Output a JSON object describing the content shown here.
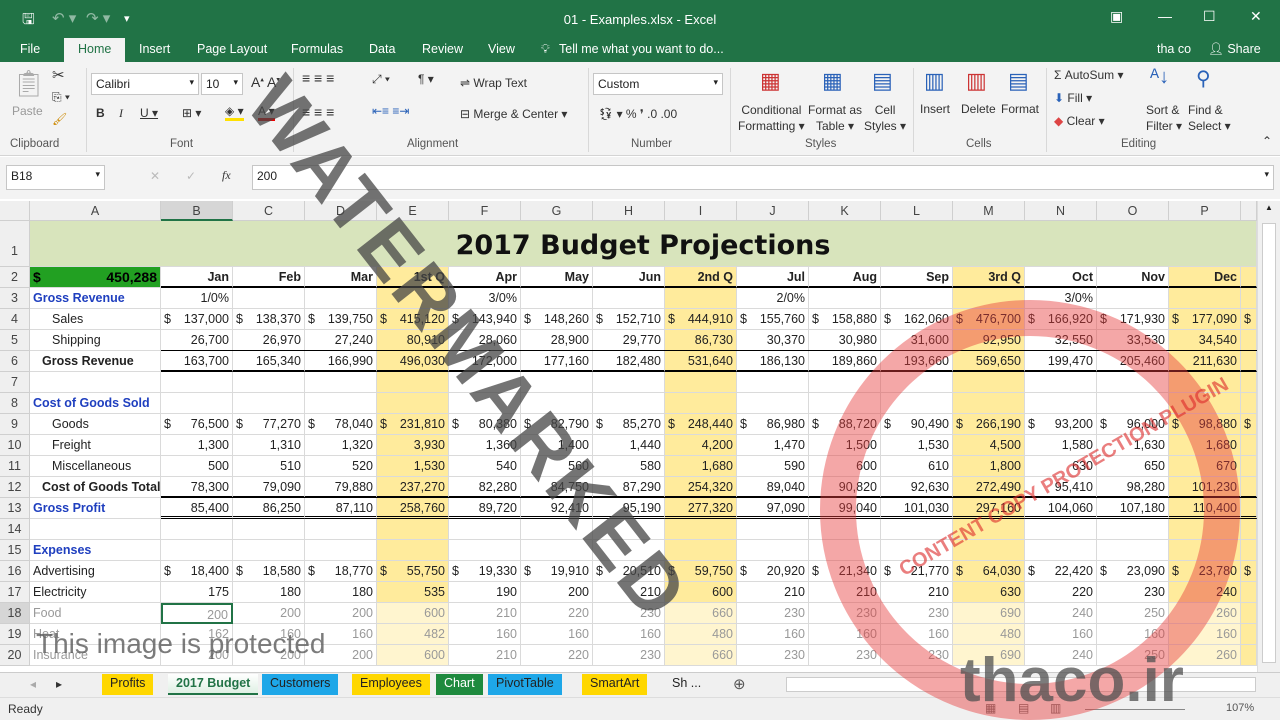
{
  "window": {
    "title": "01 - Examples.xlsx - Excel",
    "user": "tha co",
    "share": "Share"
  },
  "ribbon_tabs": [
    "File",
    "Home",
    "Insert",
    "Page Layout",
    "Formulas",
    "Data",
    "Review",
    "View"
  ],
  "tell_me": "Tell me what you want to do...",
  "ribbon": {
    "paste": "Paste",
    "font_name": "Calibri",
    "font_size": "10",
    "wrap_text": "Wrap Text",
    "merge_center": "Merge & Center",
    "number_format": "Custom",
    "conditional_formatting": [
      "Conditional",
      "Formatting ▾"
    ],
    "format_as_table": [
      "Format as",
      "Table ▾"
    ],
    "cell_styles": [
      "Cell",
      "Styles ▾"
    ],
    "insert": "Insert",
    "delete": "Delete",
    "format": "Format",
    "autosum": "AutoSum",
    "fill": "Fill",
    "clear": "Clear",
    "sort_filter": [
      "Sort &",
      "Filter ▾"
    ],
    "find_select": [
      "Find &",
      "Select ▾"
    ],
    "groups": [
      "Clipboard",
      "Font",
      "Alignment",
      "Number",
      "Styles",
      "Cells",
      "Editing"
    ]
  },
  "formula_bar": {
    "name_box": "B18",
    "value": "200"
  },
  "columns": [
    "A",
    "B",
    "C",
    "D",
    "E",
    "F",
    "G",
    "H",
    "I",
    "J",
    "K",
    "L",
    "M",
    "N",
    "O",
    "P"
  ],
  "sheet": {
    "title": "2017 Budget Projections",
    "total_label": "$",
    "total_value": "450,288",
    "headers": [
      "Jan",
      "Feb",
      "Mar",
      "1st Q",
      "Apr",
      "May",
      "Jun",
      "2nd Q",
      "Jul",
      "Aug",
      "Sep",
      "3rd Q",
      "Oct",
      "Nov",
      "Dec"
    ],
    "rows": [
      {
        "n": 3,
        "label": "Gross Revenue",
        "style": "blue",
        "cells": [
          "1/0%",
          "",
          "",
          "",
          "3/0%",
          "",
          "",
          "",
          "2/0%",
          "",
          "",
          "",
          "3/0%",
          "",
          ""
        ]
      },
      {
        "n": 4,
        "label": "Sales",
        "style": "indent",
        "q": "$",
        "cells": [
          "$ 137,000",
          "$ 138,370",
          "$ 139,750",
          "$ 415,120",
          "$ 143,940",
          "$ 148,260",
          "$ 152,710",
          "$ 444,910",
          "$ 155,760",
          "$ 158,880",
          "$ 162,060",
          "$ 476,700",
          "$ 166,920",
          "$ 171,930",
          "$ 177,090"
        ]
      },
      {
        "n": 5,
        "label": "Shipping",
        "style": "indent",
        "cells": [
          "26,700",
          "26,970",
          "27,240",
          "80,910",
          "28,060",
          "28,900",
          "29,770",
          "86,730",
          "30,370",
          "30,980",
          "31,600",
          "92,950",
          "32,550",
          "33,530",
          "34,540"
        ]
      },
      {
        "n": 6,
        "label": "Gross Revenue",
        "style": "total",
        "cells": [
          "163,700",
          "165,340",
          "166,990",
          "496,030",
          "172,000",
          "177,160",
          "182,480",
          "531,640",
          "186,130",
          "189,860",
          "193,660",
          "569,650",
          "199,470",
          "205,460",
          "211,630"
        ]
      },
      {
        "n": 7,
        "label": "",
        "cells": []
      },
      {
        "n": 8,
        "label": "Cost of Goods Sold",
        "style": "blue",
        "cells": []
      },
      {
        "n": 9,
        "label": "Goods",
        "style": "indent",
        "q": "$",
        "cells": [
          "$ 76,500",
          "$ 77,270",
          "$ 78,040",
          "$ 231,810",
          "$ 80,380",
          "$ 82,790",
          "$ 85,270",
          "$ 248,440",
          "$ 86,980",
          "$ 88,720",
          "$ 90,490",
          "$ 266,190",
          "$ 93,200",
          "$ 96,000",
          "$ 98,880"
        ]
      },
      {
        "n": 10,
        "label": "Freight",
        "style": "indent",
        "cells": [
          "1,300",
          "1,310",
          "1,320",
          "3,930",
          "1,360",
          "1,400",
          "1,440",
          "4,200",
          "1,470",
          "1,500",
          "1,530",
          "4,500",
          "1,580",
          "1,630",
          "1,680"
        ]
      },
      {
        "n": 11,
        "label": "Miscellaneous",
        "style": "indent",
        "cells": [
          "500",
          "510",
          "520",
          "1,530",
          "540",
          "560",
          "580",
          "1,680",
          "590",
          "600",
          "610",
          "1,800",
          "630",
          "650",
          "670"
        ]
      },
      {
        "n": 12,
        "label": "Cost of Goods Total",
        "style": "total",
        "cells": [
          "78,300",
          "79,090",
          "79,880",
          "237,270",
          "82,280",
          "84,750",
          "87,290",
          "254,320",
          "89,040",
          "90,820",
          "92,630",
          "272,490",
          "95,410",
          "98,280",
          "101,230"
        ]
      },
      {
        "n": 13,
        "label": "Gross Profit",
        "style": "blue",
        "cells": [
          "85,400",
          "86,250",
          "87,110",
          "258,760",
          "89,720",
          "92,410",
          "95,190",
          "277,320",
          "97,090",
          "99,040",
          "101,030",
          "297,160",
          "104,060",
          "107,180",
          "110,400"
        ]
      },
      {
        "n": 14,
        "label": "",
        "cells": []
      },
      {
        "n": 15,
        "label": "Expenses",
        "style": "blue",
        "cells": []
      },
      {
        "n": 16,
        "label": "Advertising",
        "q": "$",
        "cells": [
          "$ 18,400",
          "$ 18,580",
          "$ 18,770",
          "$ 55,750",
          "$ 19,330",
          "$ 19,910",
          "$ 20,510",
          "$ 59,750",
          "$ 20,920",
          "$ 21,340",
          "$ 21,770",
          "$ 64,030",
          "$ 22,420",
          "$ 23,090",
          "$ 23,780"
        ]
      },
      {
        "n": 17,
        "label": "Electricity",
        "cells": [
          "175",
          "180",
          "180",
          "535",
          "190",
          "200",
          "210",
          "600",
          "210",
          "210",
          "210",
          "630",
          "220",
          "230",
          "240"
        ]
      },
      {
        "n": 18,
        "label": "Food",
        "style": "faded",
        "cells": [
          "200",
          "200",
          "200",
          "600",
          "210",
          "220",
          "230",
          "660",
          "230",
          "230",
          "230",
          "690",
          "240",
          "250",
          "260"
        ]
      },
      {
        "n": 19,
        "label": "Heat",
        "style": "faded",
        "cells": [
          "162",
          "160",
          "160",
          "482",
          "160",
          "160",
          "160",
          "480",
          "160",
          "160",
          "160",
          "480",
          "160",
          "160",
          "160"
        ]
      },
      {
        "n": 20,
        "label": "Insurance",
        "style": "faded",
        "cells": [
          "200",
          "200",
          "200",
          "600",
          "210",
          "220",
          "230",
          "660",
          "230",
          "230",
          "230",
          "690",
          "240",
          "250",
          "260"
        ]
      }
    ]
  },
  "sheet_tabs": [
    {
      "label": "Profits",
      "color": "#ffd700"
    },
    {
      "label": "2017 Budget",
      "color": "#ffffff",
      "active": true
    },
    {
      "label": "Customers",
      "color": "#1ea7e8"
    },
    {
      "label": "Employees",
      "color": "#ffd700"
    },
    {
      "label": "Chart",
      "color": "#1e8a3e"
    },
    {
      "label": "PivotTable",
      "color": "#1ea7e8"
    },
    {
      "label": "SmartArt",
      "color": "#ffd700"
    },
    {
      "label": "Sh ...",
      "color": "#f0f0f0"
    }
  ],
  "status": {
    "text": "Ready",
    "zoom": "107%"
  },
  "watermarks": {
    "diagonal": "WATERMARKED",
    "protected": "This image is protected",
    "stamp": "CONTENT COPY PROTECTION PLUGIN",
    "brand": "thaco.ir"
  },
  "colors": {
    "excel_green": "#217346",
    "quarter_fill": "#ffeb9c",
    "title_band": "#d8e4bc",
    "total_cell": "#22a022",
    "section_blue": "#1f3fbf"
  }
}
